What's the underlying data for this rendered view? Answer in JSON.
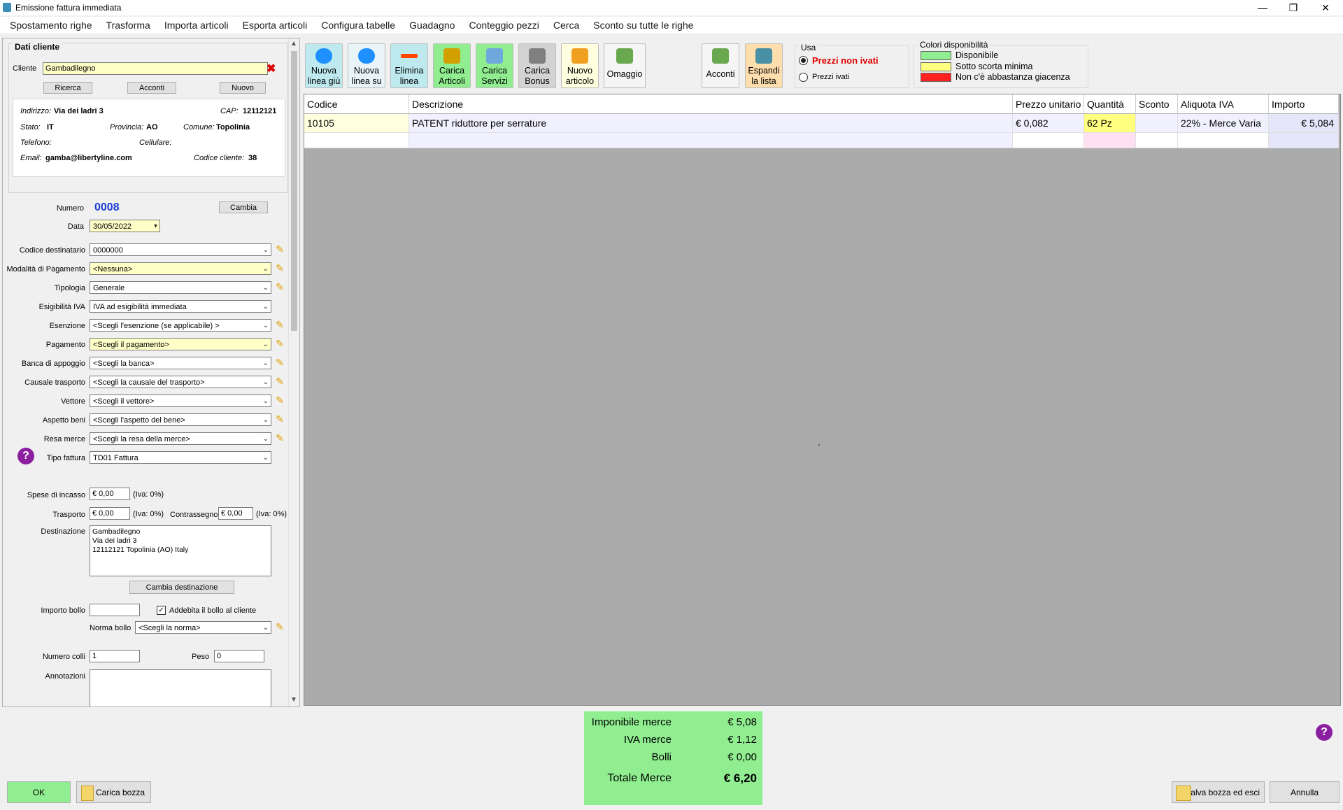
{
  "window": {
    "title": "Emissione fattura immediata"
  },
  "menu": [
    "Spostamento righe",
    "Trasforma",
    "Importa articoli",
    "Esporta articoli",
    "Configura tabelle",
    "Guadagno",
    "Conteggio pezzi",
    "Cerca",
    "Sconto su tutte le righe"
  ],
  "cliente": {
    "section_title": "Dati cliente",
    "label": "Cliente",
    "value": "Gambadilegno",
    "buttons": {
      "ricerca": "Ricerca",
      "acconti": "Acconti",
      "nuovo": "Nuovo"
    },
    "info": {
      "indirizzo_label": "Indirizzo:",
      "indirizzo": "Via dei ladri 3",
      "cap_label": "CAP:",
      "cap": "12112121",
      "stato_label": "Stato:",
      "stato": "IT",
      "provincia_label": "Provincia:",
      "provincia": "AO",
      "comune_label": "Comune:",
      "comune": "Topolinia",
      "telefono_label": "Telefono:",
      "cellulare_label": "Cellulare:",
      "email_label": "Email:",
      "email": "gamba@libertyline.com",
      "codice_label": "Codice cliente:",
      "codice": "38"
    }
  },
  "documento": {
    "numero_label": "Numero",
    "numero": "0008",
    "cambia": "Cambia",
    "data_label": "Data",
    "data": "30/05/2022"
  },
  "fields": [
    {
      "label": "Codice destinatario",
      "value": "0000000",
      "yellow": false,
      "pencil": true
    },
    {
      "label": "Modalità di Pagamento",
      "value": "<Nessuna>",
      "yellow": true,
      "pencil": true
    },
    {
      "label": "Tipologia",
      "value": "Generale",
      "yellow": false,
      "pencil": true
    },
    {
      "label": "Esigibilità IVA",
      "value": "IVA ad esigibilità immediata",
      "yellow": false,
      "pencil": false
    },
    {
      "label": "Esenzione",
      "value": "<Scegli l'esenzione (se applicabile) >",
      "yellow": false,
      "pencil": true
    },
    {
      "label": "Pagamento",
      "value": "<Scegli il pagamento>",
      "yellow": true,
      "pencil": true
    },
    {
      "label": "Banca di appoggio",
      "value": "<Scegli la banca>",
      "yellow": false,
      "pencil": true
    },
    {
      "label": "Causale trasporto",
      "value": "<Scegli la causale del trasporto>",
      "yellow": false,
      "pencil": true
    },
    {
      "label": "Vettore",
      "value": "<Scegli il vettore>",
      "yellow": false,
      "pencil": true
    },
    {
      "label": "Aspetto beni",
      "value": "<Scegli l'aspetto del bene>",
      "yellow": false,
      "pencil": true
    },
    {
      "label": "Resa merce",
      "value": "<Scegli la resa della merce>",
      "yellow": false,
      "pencil": true
    },
    {
      "label": "Tipo fattura",
      "value": "TD01 Fattura",
      "yellow": false,
      "pencil": false
    }
  ],
  "spese": {
    "incasso_label": "Spese di incasso",
    "incasso": "€ 0,00",
    "incasso_iva": "(Iva: 0%)",
    "trasporto_label": "Trasporto",
    "trasporto": "€ 0,00",
    "trasporto_iva": "(Iva: 0%)",
    "contrassegno_label": "Contrassegno",
    "contrassegno": "€ 0,00",
    "contrassegno_iva": "(Iva: 0%)"
  },
  "destinazione": {
    "label": "Destinazione",
    "lines": [
      "Gambadilegno",
      "Via dei ladri 3",
      "12112121 Topolinia  (AO) Italy"
    ],
    "cambia": "Cambia destinazione"
  },
  "bollo": {
    "importo_label": "Importo bollo",
    "importo": "",
    "addebita_label": "Addebita il bollo al cliente",
    "addebita": true,
    "norma_label": "Norma bollo",
    "norma": "<Scegli la norma>"
  },
  "colli": {
    "label": "Numero colli",
    "value": "1",
    "peso_label": "Peso",
    "peso": "0"
  },
  "annotazioni": {
    "label": "Annotazioni",
    "value": ""
  },
  "toolbar": [
    {
      "label1": "Nuova",
      "label2": "linea giù",
      "bg": "#bde9ef",
      "icon": "arrow-down-icon",
      "iconColor": "#1e90ff"
    },
    {
      "label1": "Nuova",
      "label2": "linea su",
      "bg": "#e8f4f8",
      "icon": "arrow-up-icon",
      "iconColor": "#1e90ff"
    },
    {
      "label1": "Elimina",
      "label2": "linea",
      "bg": "#bde9ef",
      "icon": "minus-icon",
      "iconColor": "#ff4500"
    },
    {
      "label1": "Carica",
      "label2": "Articoli",
      "bg": "#90ee90",
      "icon": "forklift-icon",
      "iconColor": "#d2a000"
    },
    {
      "label1": "Carica",
      "label2": "Servizi",
      "bg": "#90ee90",
      "icon": "document-icon",
      "iconColor": "#6fa8dc"
    },
    {
      "label1": "Carica",
      "label2": "Bonus",
      "bg": "#d3d3d3",
      "icon": "bonus-icon",
      "iconColor": "#808080"
    },
    {
      "label1": "Nuovo",
      "label2": "articolo",
      "bg": "#ffffe0",
      "icon": "box-icon",
      "iconColor": "#f0a020"
    },
    {
      "label1": "Omaggio",
      "label2": "",
      "bg": "#f5f5f5",
      "icon": "gift-icon",
      "iconColor": "#6aa84f"
    },
    {
      "label1": "Acconti",
      "label2": "",
      "bg": "#f5f5f5",
      "icon": "money-icon",
      "iconColor": "#6aa84f"
    },
    {
      "label1": "Espandi",
      "label2": "la lista",
      "bg": "#ffdead",
      "icon": "expand-icon",
      "iconColor": "#4a90a4"
    }
  ],
  "usa": {
    "title": "Usa",
    "opt1": "Prezzi non ivati",
    "opt2": "Prezzi ivati",
    "selected": 1
  },
  "legenda": {
    "title": "Colori disponibilità",
    "items": [
      {
        "label": "Disponibile",
        "color": "#90ee90"
      },
      {
        "label": "Sotto scorta minima",
        "color": "#ffff80"
      },
      {
        "label": "Non c'è abbastanza giacenza",
        "color": "#ff2020"
      }
    ]
  },
  "grid": {
    "headers": [
      "Codice",
      "Descrizione",
      "Prezzo unitario",
      "Quantità",
      "Sconto",
      "Aliquota IVA",
      "Importo"
    ],
    "rows": [
      [
        "10105",
        "PATENT riduttore per serrature",
        "€ 0,082",
        "62 Pz",
        "",
        "22% - Merce Varia",
        "€ 5,084"
      ]
    ]
  },
  "totali": {
    "imponibile_label": "Imponibile merce",
    "imponibile": "€ 5,08",
    "iva_label": "IVA merce",
    "iva": "€ 1,12",
    "bolli_label": "Bolli",
    "bolli": "€ 0,00",
    "totale_label": "Totale Merce",
    "totale": "€ 6,20"
  },
  "footer": {
    "ok": "OK",
    "carica_bozza": "Carica bozza",
    "salva_bozza": "Salva bozza ed esci",
    "annulla": "Annulla"
  },
  "colors": {
    "green": "#90ee90",
    "yellow": "#ffffc8",
    "blue_number": "#1a3fd4",
    "red_option": "#e00000"
  }
}
